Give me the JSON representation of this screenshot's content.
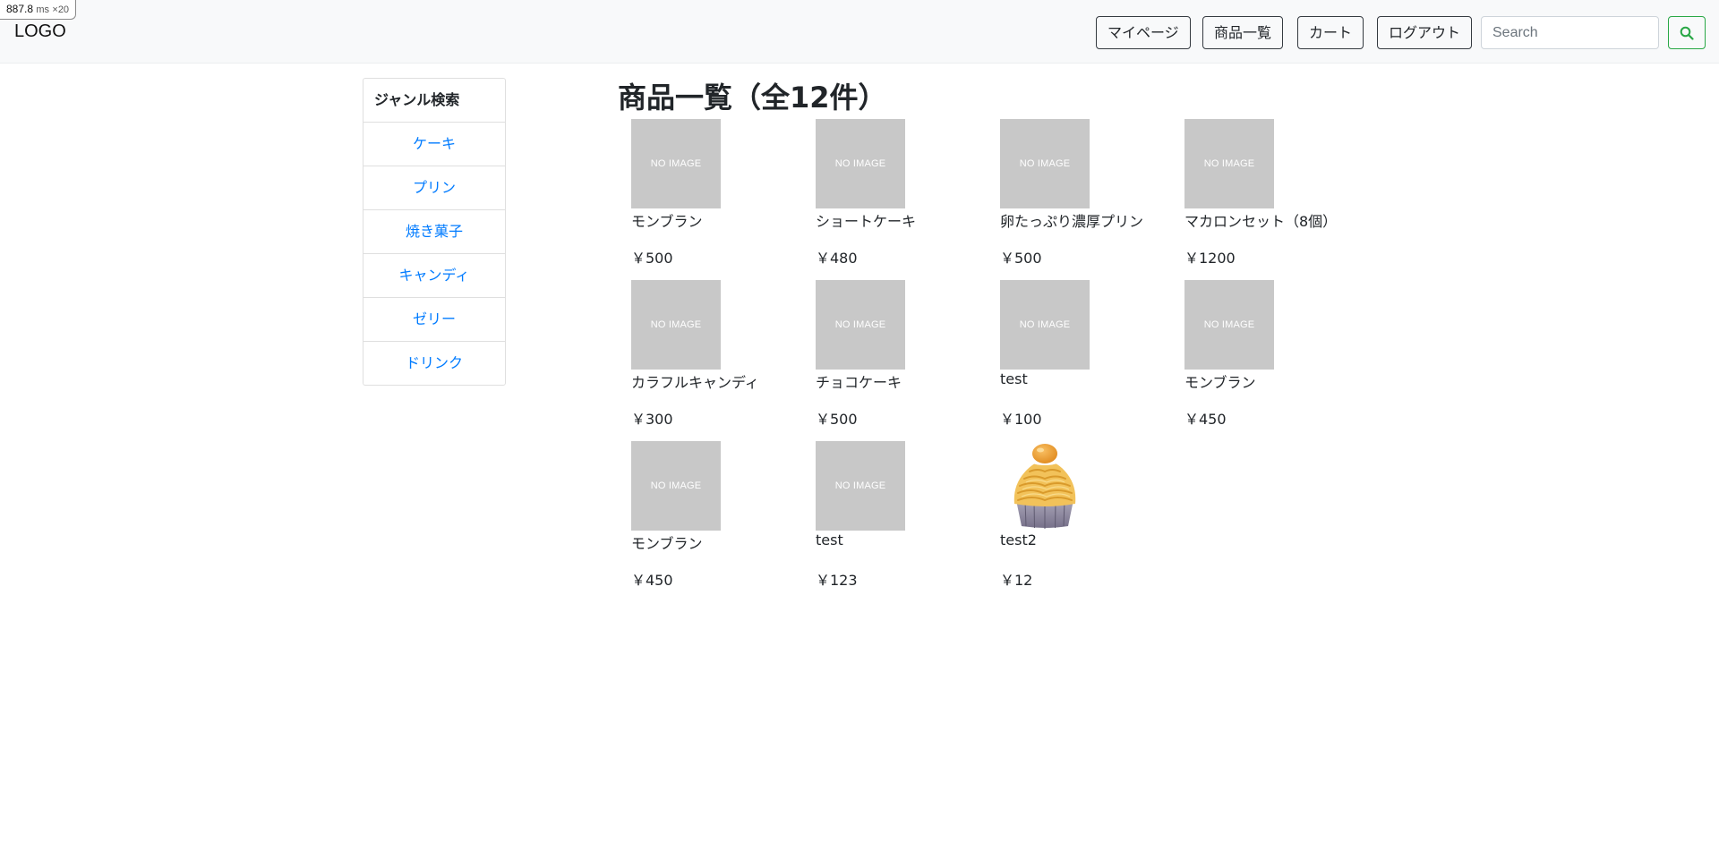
{
  "perf": {
    "value": "887.8",
    "unit": "ms",
    "multiplier": "×20"
  },
  "navbar": {
    "brand": "LOGO",
    "buttons": [
      "マイページ",
      "商品一覧",
      "カート",
      "ログアウト"
    ],
    "search_placeholder": "Search",
    "search_icon": "search-icon",
    "search_color": "#28a745"
  },
  "genres": {
    "header": "ジャンル検索",
    "items": [
      "ケーキ",
      "プリン",
      "焼き菓子",
      "キャンディ",
      "ゼリー",
      "ドリンク"
    ],
    "link_color": "#007bff"
  },
  "main": {
    "title": "商品一覧（全12件）",
    "no_image_text": "NO IMAGE",
    "products": [
      {
        "name": "モンブラン",
        "price": "￥500"
      },
      {
        "name": "ショートケーキ",
        "price": "￥480"
      },
      {
        "name": "卵たっぷり濃厚プリン",
        "price": "￥500"
      },
      {
        "name": "マカロンセット（8個）",
        "price": "￥1200"
      },
      {
        "name": "カラフルキャンディ",
        "price": "￥300"
      },
      {
        "name": "チョコケーキ",
        "price": "￥500"
      },
      {
        "name": "test",
        "price": "￥100"
      },
      {
        "name": "モンブラン",
        "price": "￥450"
      },
      {
        "name": "モンブラン",
        "price": "￥450"
      },
      {
        "name": "test",
        "price": "￥123"
      },
      {
        "name": "test2",
        "price": "￥12",
        "image": "montblanc-cake-photo"
      }
    ]
  }
}
